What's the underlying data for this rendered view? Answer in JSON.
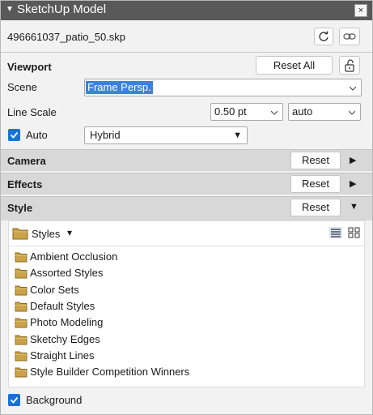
{
  "window": {
    "title": "SketchUp Model",
    "close_glyph": "×"
  },
  "file": {
    "name": "496661037_patio_50.skp",
    "refresh_icon": "refresh-icon",
    "link_icon": "link-icon"
  },
  "viewport": {
    "heading": "Viewport",
    "reset_all_label": "Reset All",
    "lock_icon": "unlock-icon",
    "scene_label": "Scene",
    "scene_value": "Frame Persp.",
    "line_scale_label": "Line Scale",
    "line_scale_value": "0.50 pt",
    "line_scale_mode": "auto",
    "auto_label": "Auto",
    "auto_checked": true,
    "render_mode": "Hybrid"
  },
  "sections": {
    "camera": {
      "label": "Camera",
      "reset_label": "Reset",
      "arrow": "▶"
    },
    "effects": {
      "label": "Effects",
      "reset_label": "Reset",
      "arrow": "▶"
    },
    "style": {
      "label": "Style",
      "reset_label": "Reset",
      "arrow": "▼"
    }
  },
  "styles": {
    "dropdown_label": "Styles",
    "dropdown_caret": "▾",
    "view_list_icon": "list-view-icon",
    "view_grid_icon": "grid-view-icon",
    "items": [
      "Ambient Occlusion",
      "Assorted Styles",
      "Color Sets",
      "Default Styles",
      "Photo Modeling",
      "Sketchy Edges",
      "Straight Lines",
      "Style Builder Competition Winners"
    ]
  },
  "background": {
    "label": "Background",
    "checked": true
  },
  "colors": {
    "accent": "#1a73d1",
    "titlebar": "#595959",
    "section_bg": "#d8d8d8",
    "selection": "#3b82e0",
    "folder": "#c9a24a"
  }
}
